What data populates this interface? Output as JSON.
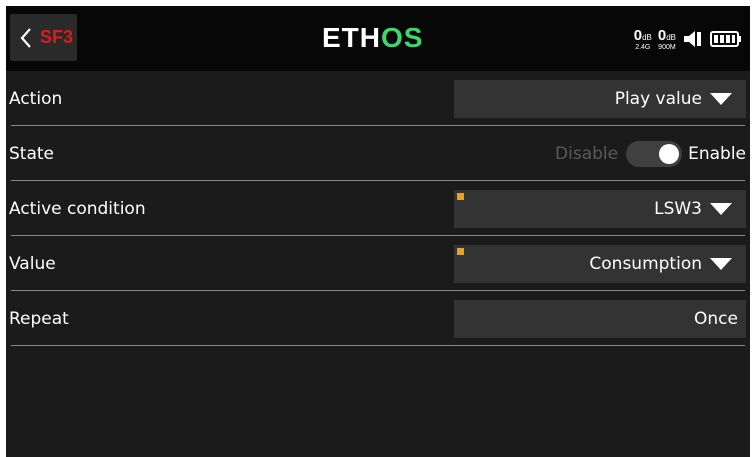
{
  "header": {
    "back_label": "SF3",
    "logo_eth": "ETH",
    "logo_os": "OS",
    "rssi_1_value": "0",
    "rssi_1_unit": "dB",
    "rssi_2_value": "0",
    "rssi_2_unit": "dB",
    "band_1": "2.4G",
    "band_2": "900M",
    "colors": {
      "back_label": "#e01a1a",
      "logo_os": "#3dd86b",
      "marker": "#f0a020"
    }
  },
  "rows": [
    {
      "label": "Action",
      "value": "Play value",
      "has_dropdown": true
    },
    {
      "label": "State",
      "toggle_off": "Disable",
      "toggle_on": "Enable",
      "toggle_state": "on"
    },
    {
      "label": "Active condition",
      "value": "LSW3",
      "has_dropdown": true,
      "marker": true
    },
    {
      "label": "Value",
      "value": "Consumption",
      "has_dropdown": true,
      "marker": true
    },
    {
      "label": "Repeat",
      "value": "Once",
      "has_dropdown": false
    }
  ]
}
